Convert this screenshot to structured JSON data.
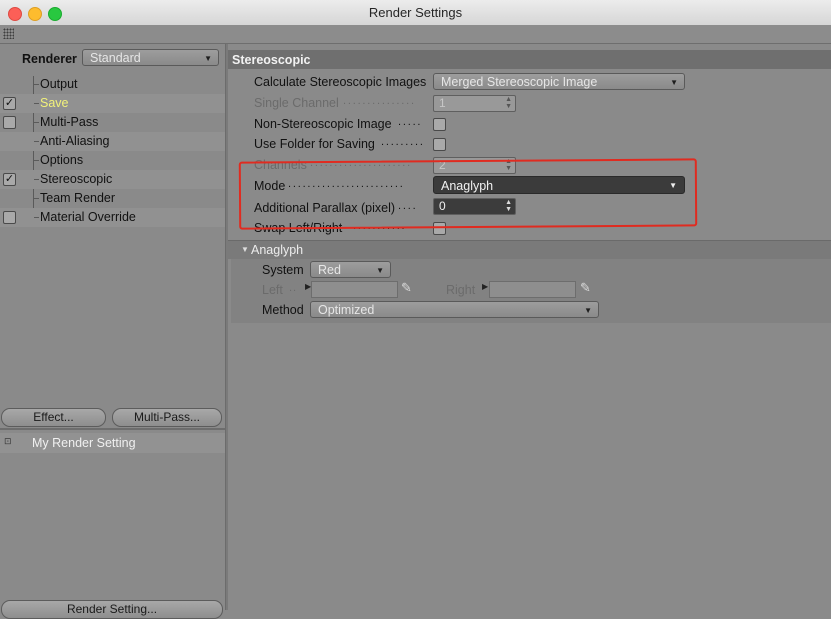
{
  "window": {
    "title": "Render Settings"
  },
  "sidebar": {
    "renderer_label": "Renderer",
    "renderer_value": "Standard",
    "items": [
      {
        "label": "Output",
        "checkbox": false,
        "checked": false,
        "selected": false
      },
      {
        "label": "Save",
        "checkbox": true,
        "checked": true,
        "selected": true
      },
      {
        "label": "Multi-Pass",
        "checkbox": true,
        "checked": false,
        "selected": false
      },
      {
        "label": "Anti-Aliasing",
        "checkbox": false,
        "checked": false,
        "selected": false
      },
      {
        "label": "Options",
        "checkbox": false,
        "checked": false,
        "selected": false
      },
      {
        "label": "Stereoscopic",
        "checkbox": true,
        "checked": true,
        "selected": false
      },
      {
        "label": "Team Render",
        "checkbox": false,
        "checked": false,
        "selected": false
      },
      {
        "label": "Material Override",
        "checkbox": true,
        "checked": false,
        "selected": false
      }
    ],
    "effect_button": "Effect...",
    "multipass_button": "Multi-Pass...",
    "setting_name": "My Render Setting",
    "bottom_button": "Render Setting..."
  },
  "main": {
    "section_title": "Stereoscopic",
    "calc_label": "Calculate Stereoscopic Images",
    "calc_value": "Merged Stereoscopic Image",
    "single_channel_label": "Single Channel",
    "single_channel_value": "1",
    "non_stereo_label": "Non-Stereoscopic Image",
    "use_folder_label": "Use Folder for Saving",
    "channels_label": "Channels",
    "channels_value": "2",
    "mode_label": "Mode",
    "mode_value": "Anaglyph",
    "parallax_label": "Additional Parallax (pixel)",
    "parallax_value": "0",
    "swap_label": "Swap Left/Right",
    "anaglyph_group": "Anaglyph",
    "system_label": "System",
    "system_value": "Red",
    "left_label": "Left",
    "right_label": "Right",
    "method_label": "Method",
    "method_value": "Optimized"
  },
  "colors": {
    "highlight_box": "#e02b20",
    "selected_item": "#f2f27a",
    "panel_bg": "#8a8a8a",
    "section_header_bg": "#6f6f6f"
  }
}
